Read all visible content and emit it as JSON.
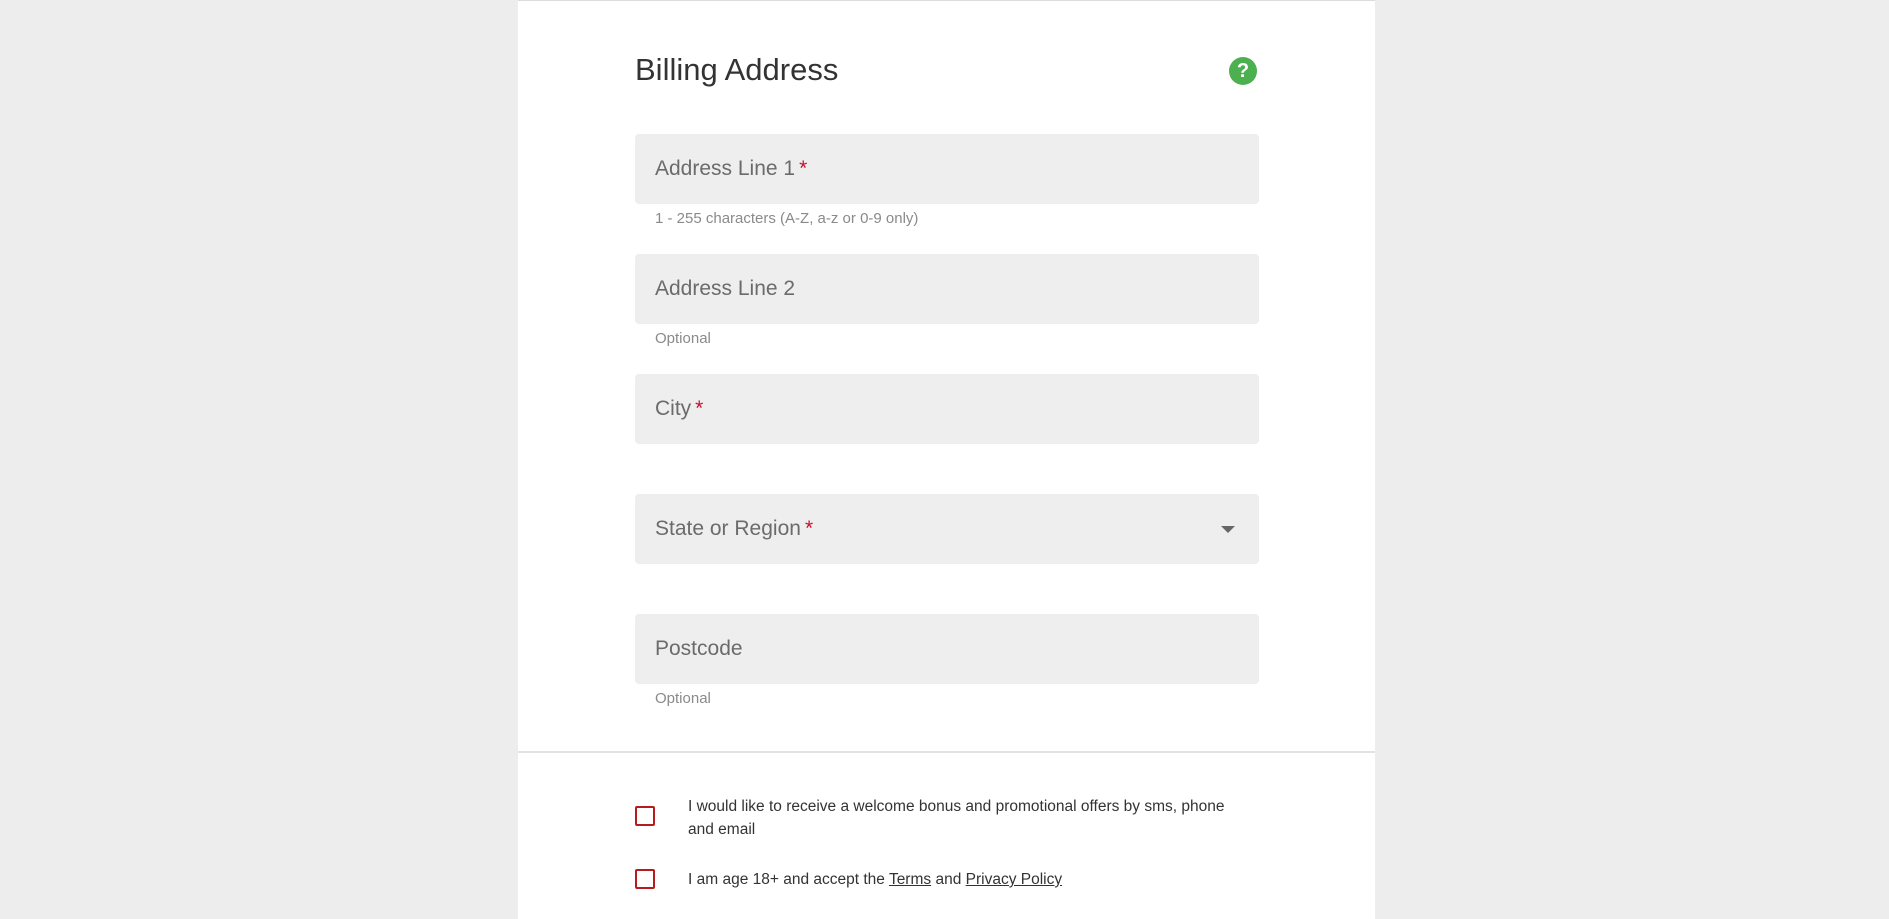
{
  "form": {
    "title": "Billing Address",
    "help_icon_glyph": "?",
    "required_mark": "*",
    "address_line_1": {
      "label": "Address Line 1",
      "hint": "1 - 255 characters (A-Z, a-z or 0-9 only)"
    },
    "address_line_2": {
      "label": "Address Line 2",
      "hint": "Optional"
    },
    "city": {
      "label": "City"
    },
    "state": {
      "label": "State or Region"
    },
    "postcode": {
      "label": "Postcode",
      "hint": "Optional"
    }
  },
  "consents": {
    "promo": {
      "text": "I would like to receive a welcome bonus and promotional offers by sms, phone and email"
    },
    "age": {
      "text_prefix": "I am age 18+ and accept the",
      "terms_link": "Terms",
      "conjunction": "and",
      "privacy_link": "Privacy Policy"
    }
  },
  "colors": {
    "accent_green": "#4caf50",
    "required_red": "#c8102e",
    "checkbox_border": "#b71c1c",
    "field_bg": "#eeeeee",
    "page_bg": "#ededed"
  }
}
